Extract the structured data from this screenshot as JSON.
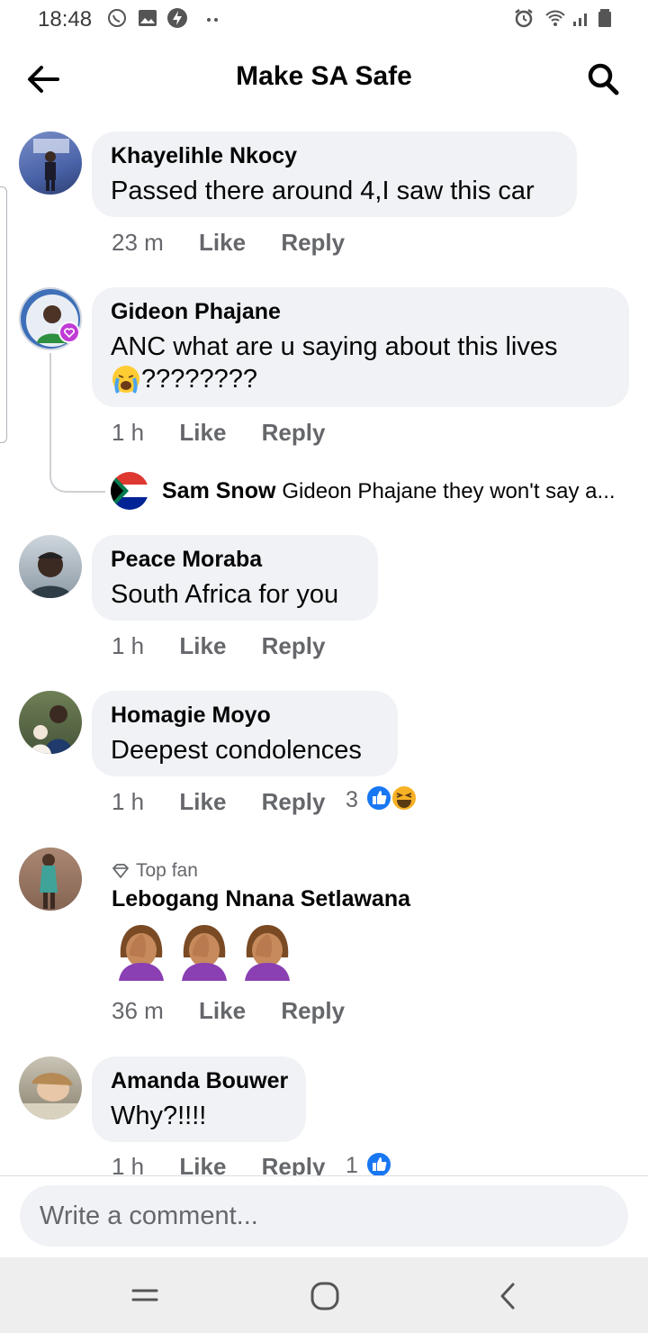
{
  "status_bar": {
    "time": "18:48"
  },
  "header": {
    "title": "Make SA Safe"
  },
  "comments": [
    {
      "author": "Khayelihle Nkocy",
      "text": "Passed there around 4,I saw this car",
      "time": "23 m",
      "like": "Like",
      "reply": "Reply"
    },
    {
      "author": "Gideon Phajane",
      "text_line1": "ANC what are u saying about this lives",
      "text_line2": "????????",
      "time": "1 h",
      "like": "Like",
      "reply": "Reply",
      "reply_preview": {
        "author": "Sam Snow",
        "text": "Gideon Phajane they won't say a..."
      }
    },
    {
      "author": "Peace Moraba",
      "text": "South Africa for you",
      "time": "1 h",
      "like": "Like",
      "reply": "Reply"
    },
    {
      "author": "Homagie Moyo",
      "text": "Deepest condolences",
      "time": "1 h",
      "like": "Like",
      "reply": "Reply",
      "reactions_count": "3"
    },
    {
      "badge": "Top fan",
      "author": "Lebogang Nnana Setlawana",
      "time": "36 m",
      "like": "Like",
      "reply": "Reply"
    },
    {
      "author": "Amanda Bouwer",
      "text": "Why?!!!!",
      "time": "1 h",
      "like": "Like",
      "reply": "Reply",
      "reactions_count": "1"
    }
  ],
  "composer": {
    "placeholder": "Write a comment..."
  },
  "colors": {
    "bubble": "#f0f2f5",
    "meta": "#65676b",
    "like_blue": "#1877f2"
  }
}
